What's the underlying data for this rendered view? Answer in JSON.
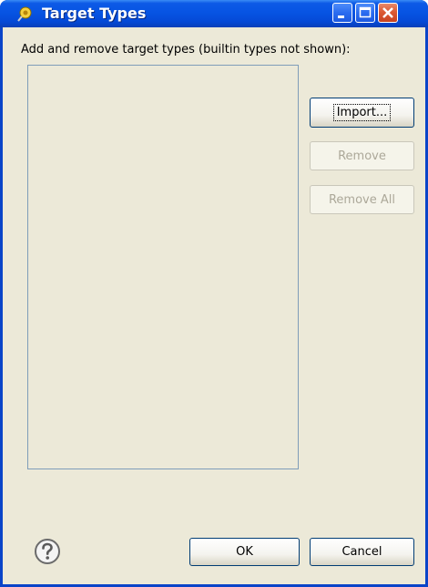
{
  "window": {
    "title": "Target Types",
    "controls": {
      "minimize": "minimize",
      "maximize": "maximize",
      "close": "close"
    }
  },
  "dialog": {
    "instructions": "Add and remove target types (builtin types not shown):",
    "target_types_list": [],
    "buttons": {
      "import": "Import...",
      "remove": "Remove",
      "remove_all": "Remove All",
      "ok": "OK",
      "cancel": "Cancel"
    },
    "help_icon": "question-mark-icon"
  },
  "colors": {
    "titlebar": "#0754e3",
    "client_bg": "#ece9d8",
    "button_border": "#003c74",
    "disabled_text": "#aca899",
    "close_button": "#dc5a33"
  }
}
